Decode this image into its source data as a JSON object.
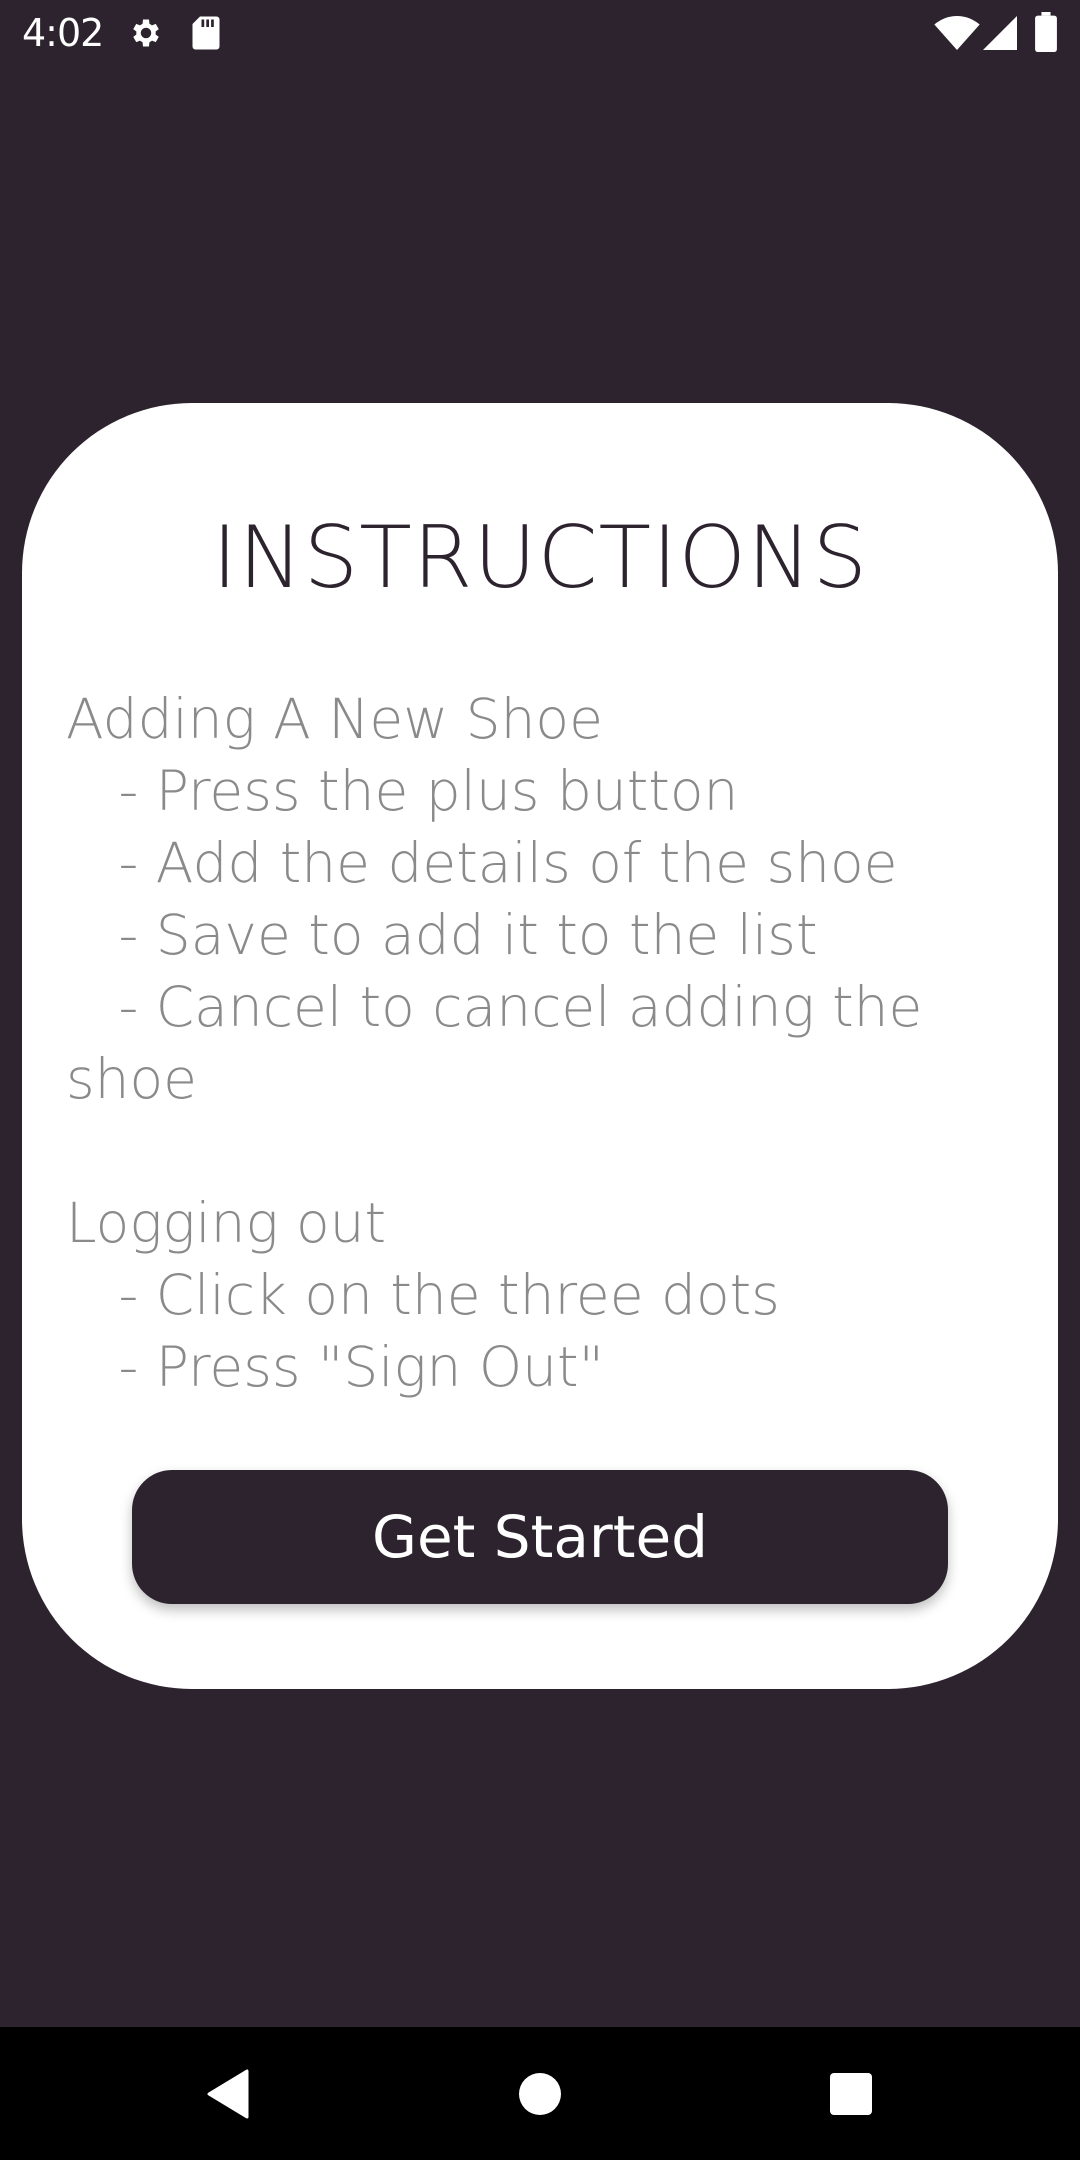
{
  "status_bar": {
    "time": "4:02",
    "left_icons": [
      "gear-icon",
      "sd-card-icon"
    ],
    "right_icons": [
      "wifi-icon",
      "cell-signal-icon",
      "battery-icon"
    ]
  },
  "card": {
    "title": "INSTRUCTIONS",
    "body": "Adding A New Shoe\n   - Press the plus button\n   - Add the details of the shoe\n   - Save to add it to the list\n   - Cancel to cancel adding the shoe\n\nLogging out\n   - Click on the three dots\n   - Press \"Sign Out\"",
    "button_label": "Get Started"
  },
  "nav_bar": {
    "buttons": [
      "back-icon",
      "home-icon",
      "recents-icon"
    ]
  },
  "colors": {
    "background": "#2d232f",
    "card": "#ffffff",
    "body_text": "#8a8a8a"
  }
}
